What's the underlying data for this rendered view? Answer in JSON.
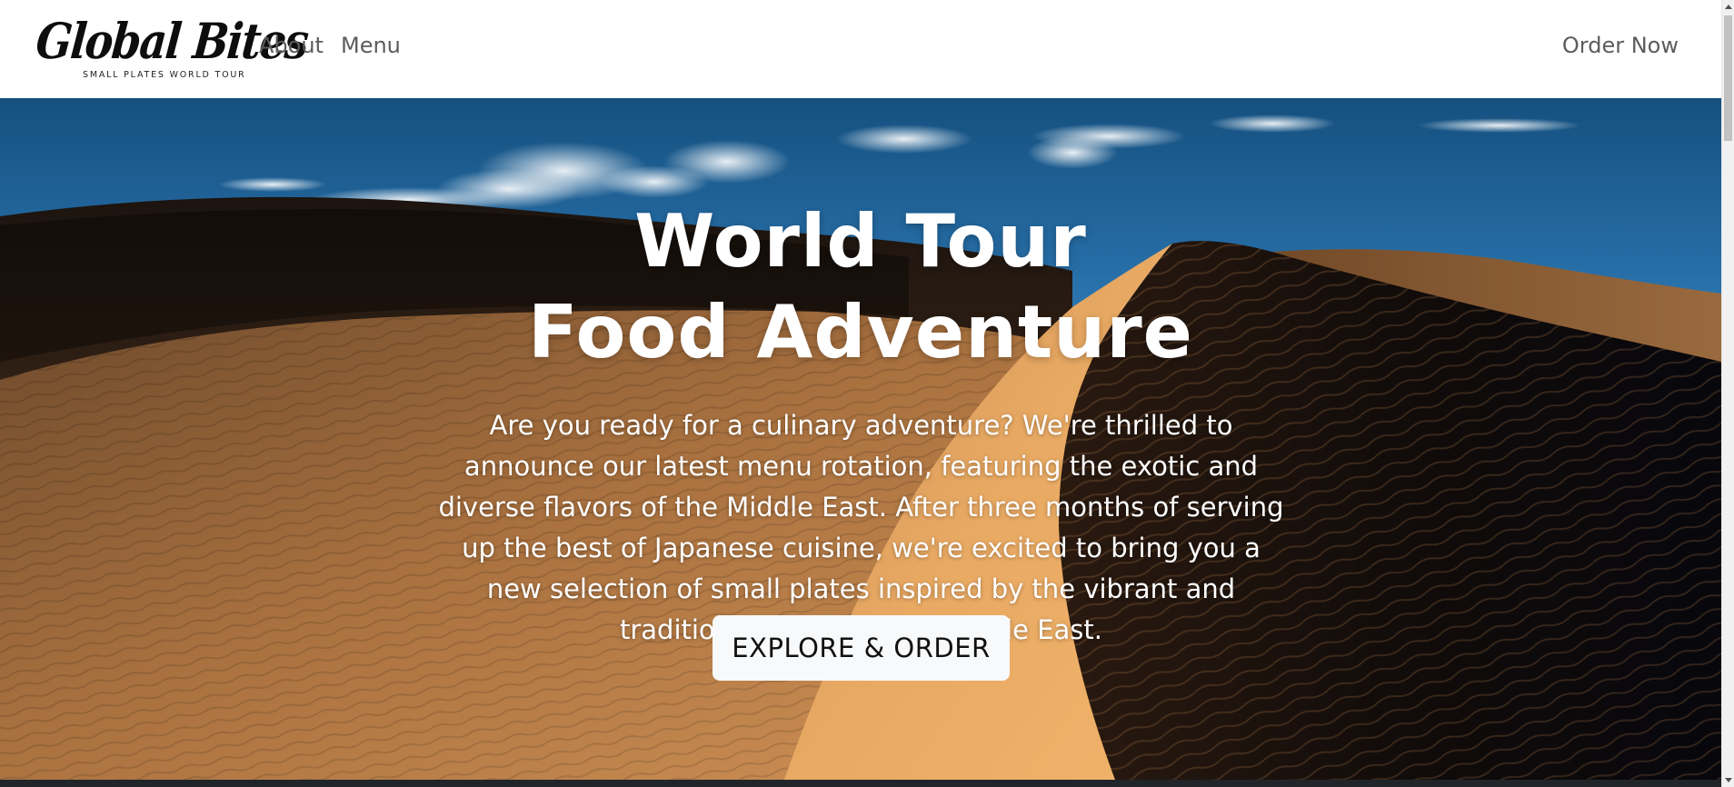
{
  "nav": {
    "brand_name": "Global Bites",
    "brand_tagline": "SMALL PLATES WORLD TOUR",
    "links": [
      {
        "label": "About"
      },
      {
        "label": "Menu"
      }
    ],
    "order_label": "Order Now"
  },
  "hero": {
    "title_line1": "World Tour",
    "title_line2": "Food Adventure",
    "description": "Are you ready for a culinary adventure? We're thrilled to announce our latest menu rotation, featuring the exotic and diverse flavors of the Middle East. After three months of serving up the best of Japanese cuisine, we're excited to bring you a new selection of small plates inspired by the vibrant and traditional dishes of the Middle East.",
    "cta_label": "EXPLORE & ORDER",
    "background": "desert-dunes-image"
  },
  "colors": {
    "sky_top": "#1a5a93",
    "sky_bottom": "#3d86c0",
    "sand_light": "#e6a766",
    "sand_mid": "#c28450",
    "sand_dark": "#5a3a22",
    "shadow": "#0a0a10",
    "button_bg": "#f8f9fa",
    "nav_link": "#5c5c5c"
  }
}
